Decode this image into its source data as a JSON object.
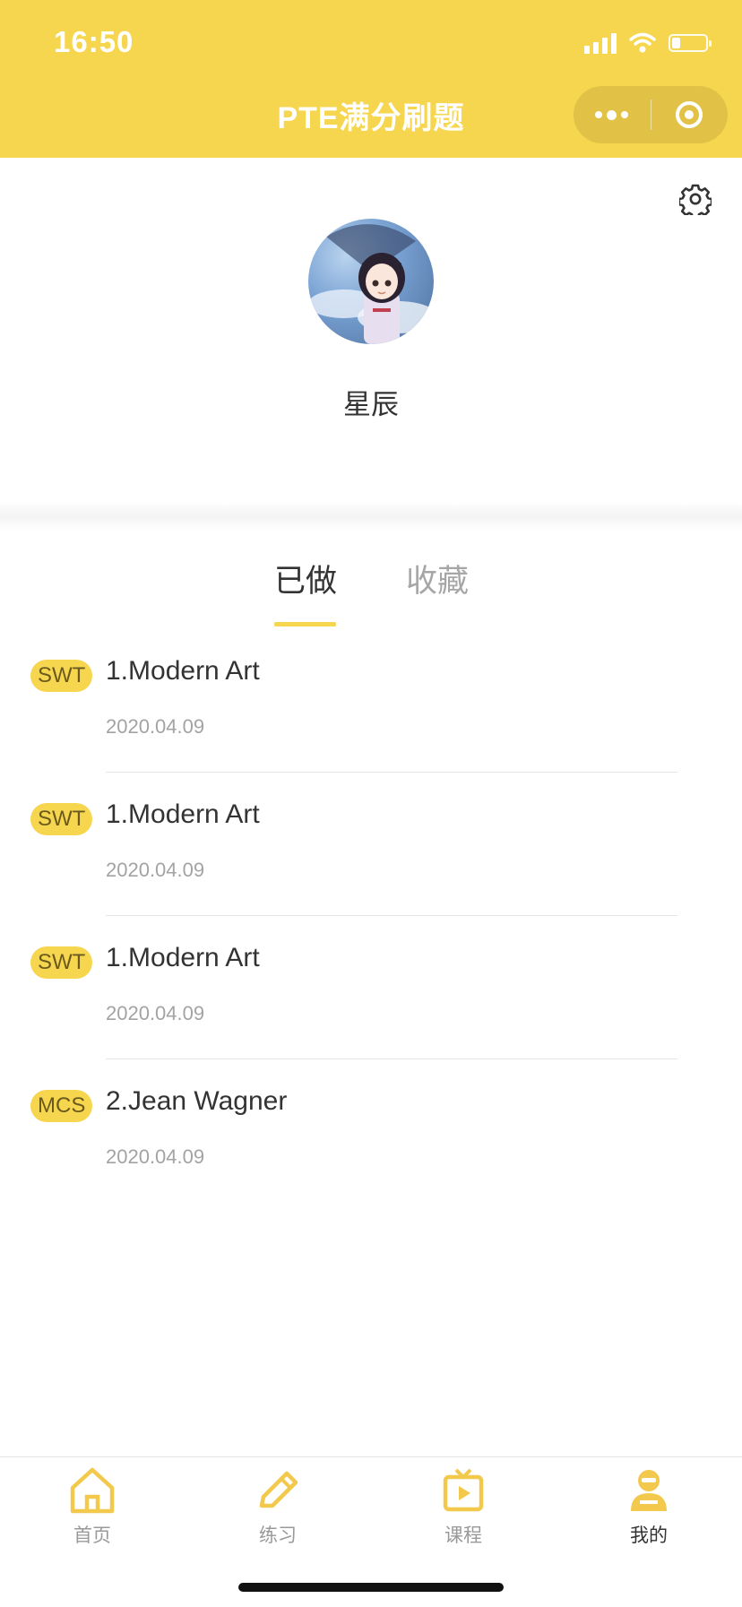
{
  "status_bar": {
    "time": "16:50"
  },
  "nav": {
    "title": "PTE满分刷题"
  },
  "profile": {
    "name": "星辰"
  },
  "tabs": [
    {
      "label": "已做",
      "active": true
    },
    {
      "label": "收藏",
      "active": false
    }
  ],
  "records": [
    {
      "tag": "SWT",
      "title": "1.Modern Art",
      "date": "2020.04.09"
    },
    {
      "tag": "SWT",
      "title": "1.Modern Art",
      "date": "2020.04.09"
    },
    {
      "tag": "SWT",
      "title": "1.Modern Art",
      "date": "2020.04.09"
    },
    {
      "tag": "MCS",
      "title": "2.Jean Wagner",
      "date": "2020.04.09"
    }
  ],
  "tabbar": [
    {
      "label": "首页",
      "icon": "home-icon",
      "active": false
    },
    {
      "label": "练习",
      "icon": "pencil-icon",
      "active": false
    },
    {
      "label": "课程",
      "icon": "tv-play-icon",
      "active": false
    },
    {
      "label": "我的",
      "icon": "user-icon",
      "active": true
    }
  ],
  "colors": {
    "accent": "#f7d64f",
    "text": "#333333",
    "muted": "#a3a3a3"
  }
}
